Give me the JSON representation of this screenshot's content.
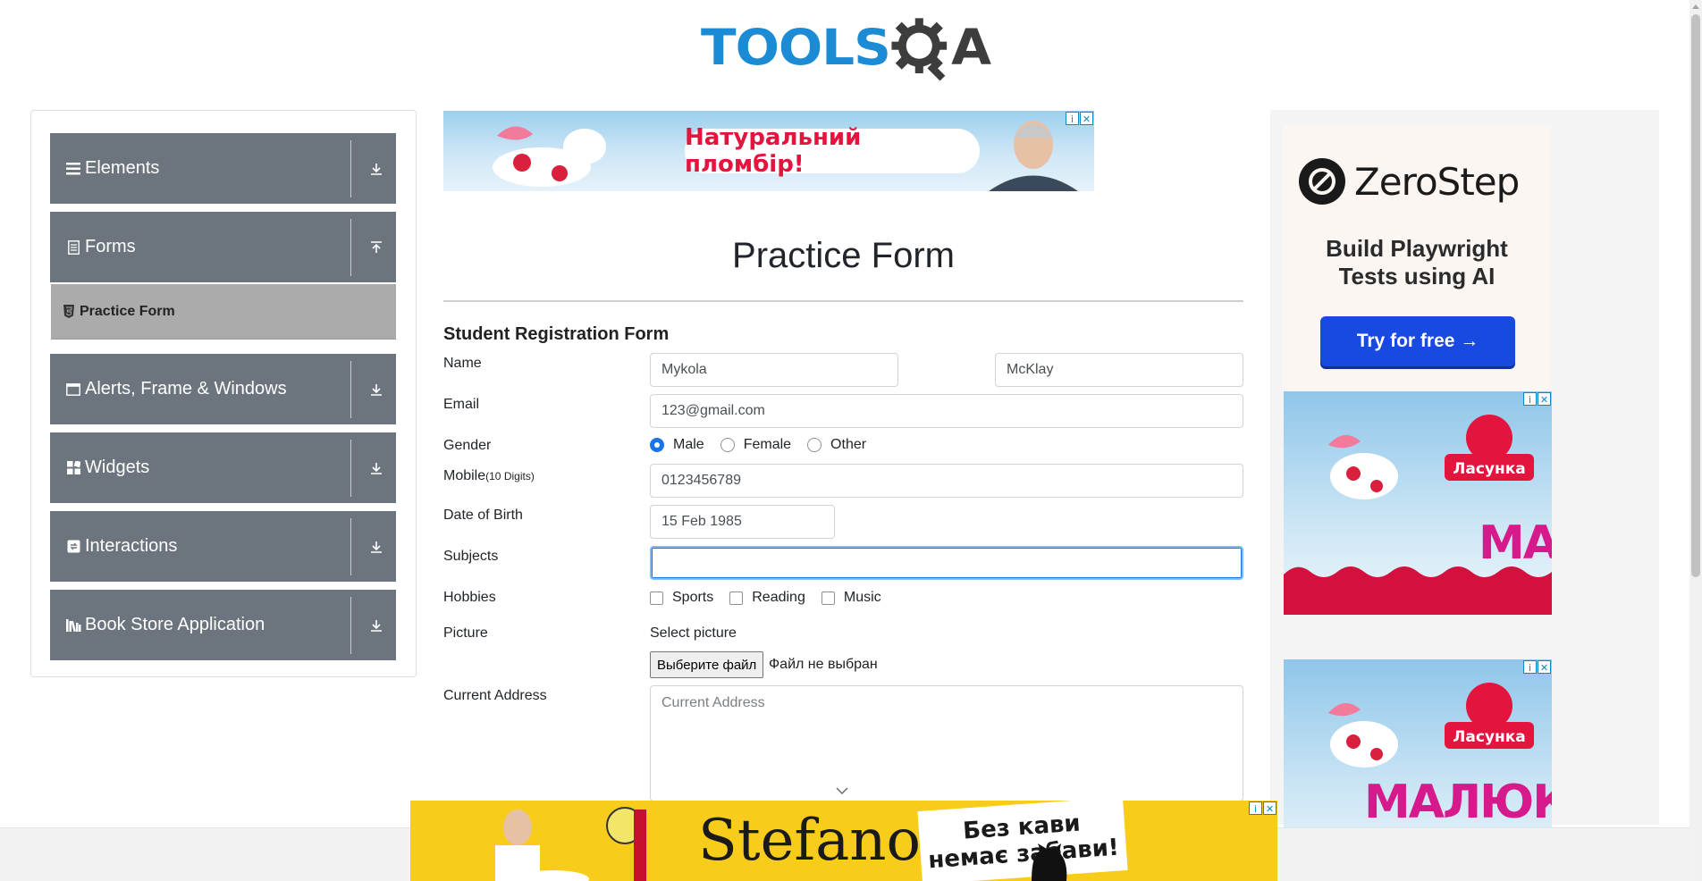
{
  "logo": {
    "part1": "TOOLS",
    "part2": "A"
  },
  "sidebar": {
    "groups": [
      {
        "label": "Elements",
        "icon": "menu-lines-icon",
        "arrow": "down"
      },
      {
        "label": "Forms",
        "icon": "document-icon",
        "arrow": "up"
      },
      {
        "label": "Alerts, Frame & Windows",
        "icon": "window-icon",
        "arrow": "down"
      },
      {
        "label": "Widgets",
        "icon": "widgets-grid-icon",
        "arrow": "down"
      },
      {
        "label": "Interactions",
        "icon": "interaction-icon",
        "arrow": "down"
      },
      {
        "label": "Book Store Application",
        "icon": "books-icon",
        "arrow": "down"
      }
    ],
    "active_item": "Practice Form"
  },
  "ads": {
    "top_banner_text": "Натуральний пломбір!",
    "zerostep_name": "ZeroStep",
    "zerostep_tagline_1": "Build Playwright",
    "zerostep_tagline_2": "Tests using AI",
    "zerostep_button": "Try for free →",
    "lasunka": "Ласунка",
    "malyuk_1": "МА",
    "malyuk_2": "МАЛЮК-А",
    "bottom_brand": "Stefano",
    "bottom_slogan_1": "Без кави",
    "bottom_slogan_2": "немає забави!"
  },
  "form": {
    "title": "Practice Form",
    "heading": "Student Registration Form",
    "labels": {
      "name": "Name",
      "email": "Email",
      "gender": "Gender",
      "mobile": "Mobile",
      "mobile_hint": "(10 Digits)",
      "dob": "Date of Birth",
      "subjects": "Subjects",
      "hobbies": "Hobbies",
      "picture": "Picture",
      "address": "Current Address"
    },
    "first_name": "Mykola",
    "last_name": "McKlay",
    "email": "123@gmail.com",
    "gender_options": [
      "Male",
      "Female",
      "Other"
    ],
    "gender_selected": "Male",
    "mobile": "0123456789",
    "dob": "15 Feb 1985",
    "subjects": "",
    "hobby_options": [
      "Sports",
      "Reading",
      "Music"
    ],
    "picture_label": "Select picture",
    "file_button": "Выберите файл",
    "file_status": "Файл не выбран",
    "address_placeholder": "Current Address"
  },
  "colors": {
    "sidebar_header": "#6c757d",
    "active_item": "#ababab",
    "logo_blue": "#1b8bd6",
    "focus_border": "#80bdff",
    "radio_selected": "#1a73e8"
  }
}
